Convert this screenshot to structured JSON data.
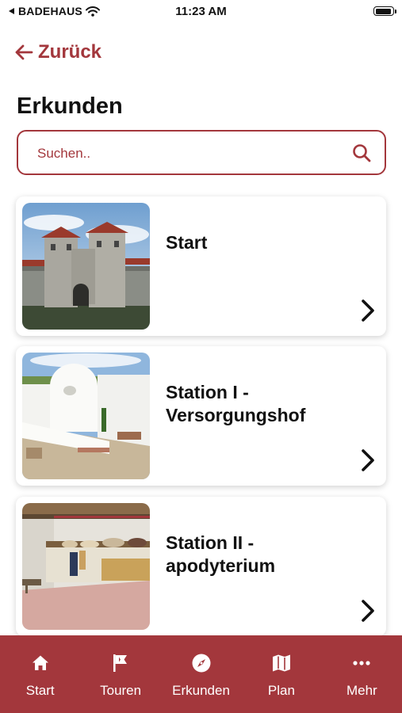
{
  "status_bar": {
    "carrier": "BADEHAUS",
    "time": "11:23 AM"
  },
  "back_label": "Zurück",
  "page_title": "Erkunden",
  "search": {
    "placeholder": "Suchen.."
  },
  "cards": [
    {
      "title": "Start"
    },
    {
      "title": "Station I - Versorgungshof"
    },
    {
      "title": "Station II - apodyterium"
    }
  ],
  "nav": {
    "tabs": [
      {
        "label": "Start",
        "icon": "home-icon"
      },
      {
        "label": "Touren",
        "icon": "flag-icon"
      },
      {
        "label": "Erkunden",
        "icon": "compass-icon"
      },
      {
        "label": "Plan",
        "icon": "map-icon"
      },
      {
        "label": "Mehr",
        "icon": "more-icon"
      }
    ]
  },
  "colors": {
    "accent": "#a3373c",
    "background": "#ffffff",
    "text": "#111111"
  }
}
